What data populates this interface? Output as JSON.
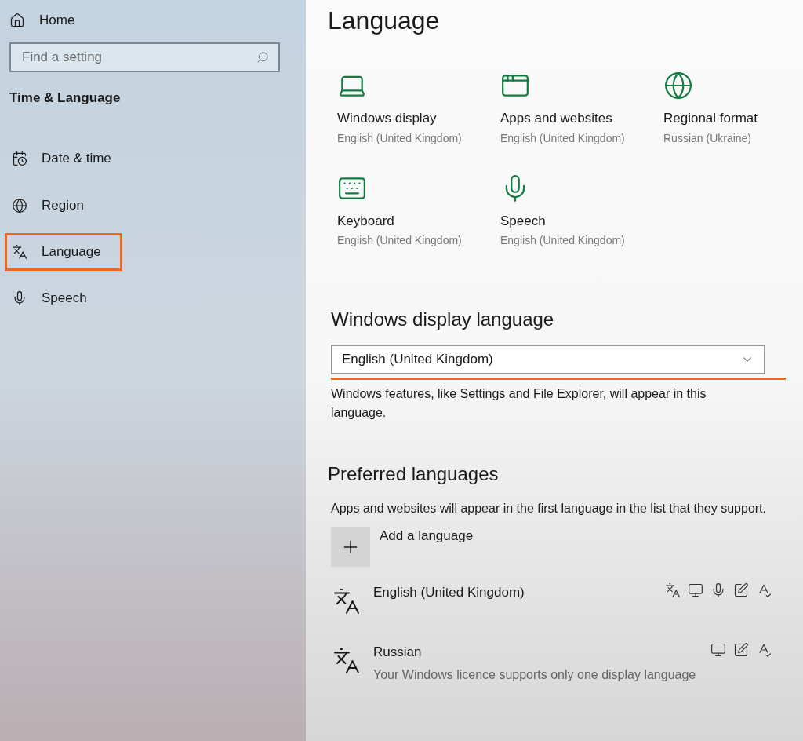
{
  "sidebar": {
    "home": {
      "label": "Home"
    },
    "search": {
      "placeholder": "Find a setting"
    },
    "section_title": "Time & Language",
    "items": [
      {
        "label": "Date & time",
        "kind": "calendar",
        "selected": false
      },
      {
        "label": "Region",
        "kind": "globe",
        "selected": false
      },
      {
        "label": "Language",
        "kind": "language",
        "selected": true
      },
      {
        "label": "Speech",
        "kind": "mic",
        "selected": false
      }
    ]
  },
  "page_title": "Language",
  "cards": [
    {
      "title": "Windows display",
      "subtitle": "English (United Kingdom)",
      "kind": "laptop"
    },
    {
      "title": "Apps and websites",
      "subtitle": "English (United Kingdom)",
      "kind": "window"
    },
    {
      "title": "Regional format",
      "subtitle": "Russian (Ukraine)",
      "kind": "globe"
    },
    {
      "title": "Keyboard",
      "subtitle": "English (United Kingdom)",
      "kind": "keyboard"
    },
    {
      "title": "Speech",
      "subtitle": "English (United Kingdom)",
      "kind": "mic"
    }
  ],
  "display_language": {
    "heading": "Windows display language",
    "value": "English (United Kingdom)",
    "description": "Windows features, like Settings and File Explorer, will appear in this language."
  },
  "preferred": {
    "heading": "Preferred languages",
    "description": "Apps and websites will appear in the first language in the list that they support.",
    "add_label": "Add a language",
    "languages": [
      {
        "name": "English (United Kingdom)",
        "features": [
          {
            "kind": "language-pack"
          },
          {
            "kind": "display"
          },
          {
            "kind": "speech"
          },
          {
            "kind": "handwriting"
          },
          {
            "kind": "spelling"
          }
        ]
      },
      {
        "name": "Russian",
        "note": "Your Windows licence supports only one display language",
        "features": [
          {
            "kind": "display"
          },
          {
            "kind": "handwriting"
          },
          {
            "kind": "spelling"
          }
        ]
      }
    ]
  }
}
